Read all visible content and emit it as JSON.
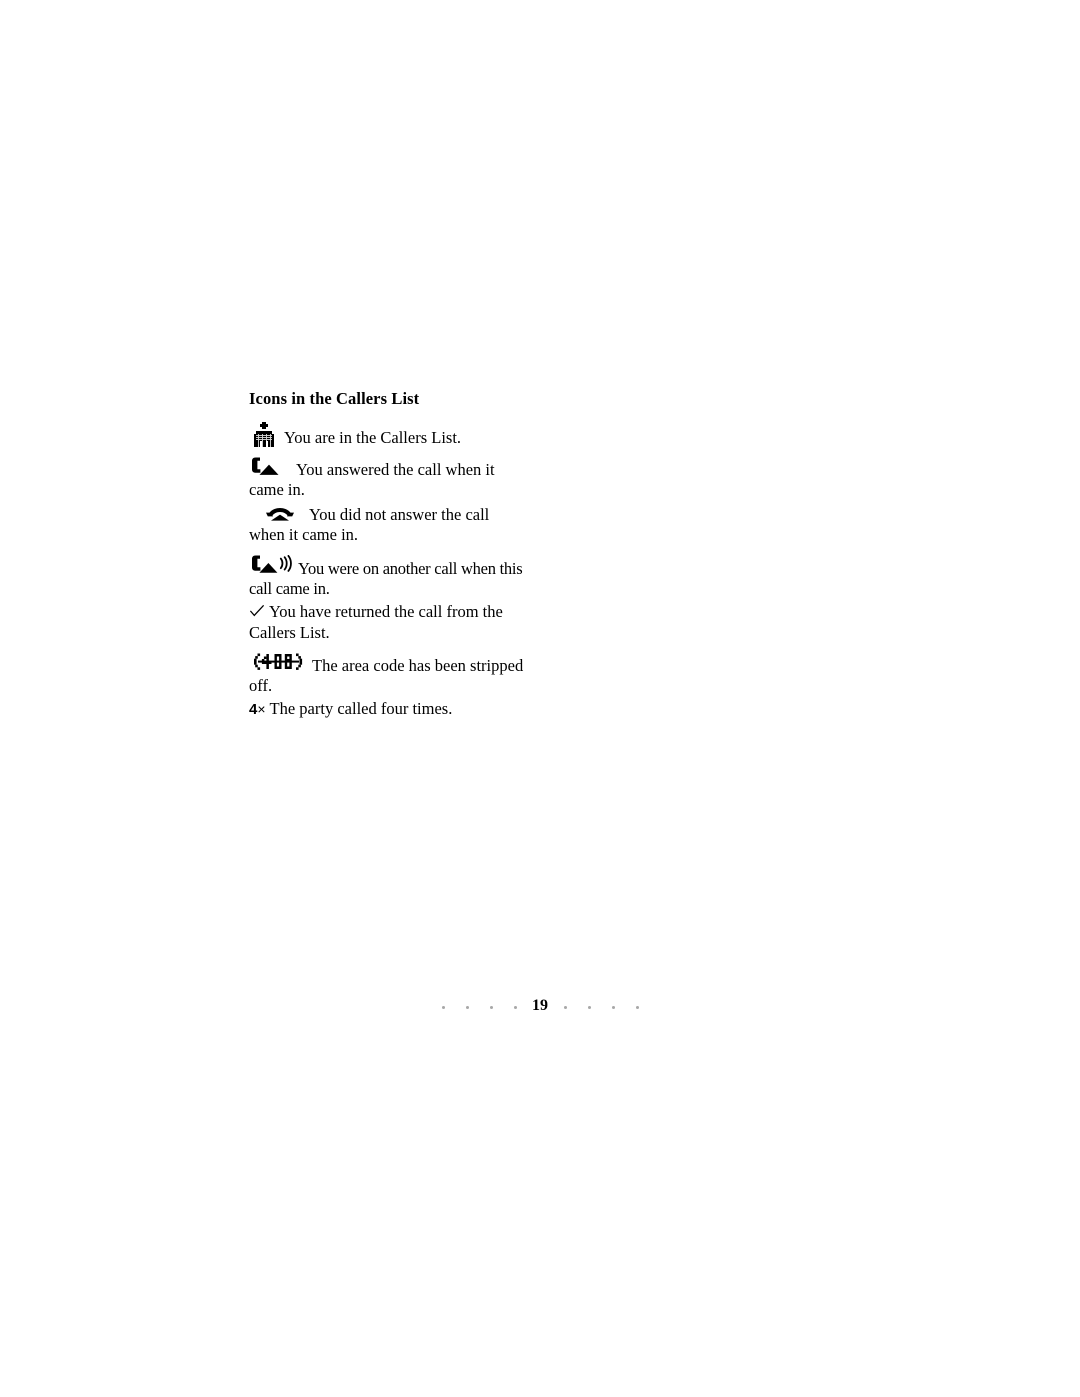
{
  "document": {
    "heading": "Icons in the Callers List",
    "entries": [
      {
        "icon": "person-in-callers-list-icon",
        "text": "You are in the Callers List."
      },
      {
        "icon": "handset-offhook-icon",
        "text": "You answered the call when it came in."
      },
      {
        "icon": "telephone-onhook-icon",
        "text": "You did not answer the call when it came in."
      },
      {
        "icon": "handset-offhook-with-waves-icon",
        "text": "You were on another call when this call came in."
      },
      {
        "icon": "checkmark-icon",
        "text": "You have returned the call from the Callers List."
      },
      {
        "icon": "area-code-stripped-icon",
        "icon_label": "(408)",
        "text": "The area code has been stripped off."
      },
      {
        "icon": "call-count-multiplier-icon",
        "icon_number": "4",
        "icon_symbol": "×",
        "text": "The party called four times."
      }
    ]
  },
  "footer": {
    "page_number": "19",
    "dot_count_left": 4,
    "dot_count_right": 4,
    "dot_color": "#a8a8a8"
  },
  "colors": {
    "background": "#ffffff",
    "text": "#000000"
  }
}
